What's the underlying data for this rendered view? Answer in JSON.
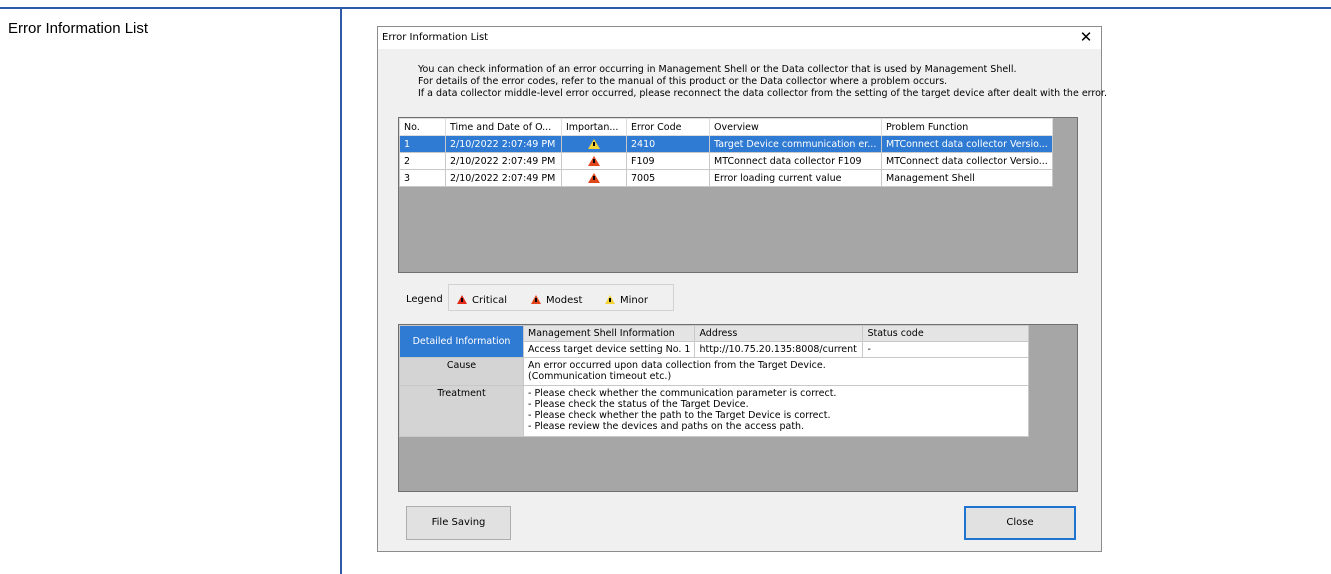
{
  "page": {
    "section_title": "Error Information List"
  },
  "dialog": {
    "title": "Error Information List",
    "close_glyph": "✕",
    "intro": [
      "You can check information of an error occurring in Management Shell or the Data collector that is used by Management Shell.",
      "For details of the error codes, refer to the manual of this product or the Data collector where a problem occurs.",
      "If a data collector middle-level error occurred, please reconnect the data collector from the setting of the target device after dealt with the error."
    ],
    "error_table": {
      "columns": [
        "No.",
        "Time and Date of O...",
        "Importan...",
        "Error Code",
        "Overview",
        "Problem Function"
      ],
      "rows": [
        {
          "no": "1",
          "time": "2/10/2022 2:07:49 PM",
          "importance": "minor",
          "code": "2410",
          "overview": "Target Device communication er...",
          "function": "MTConnect data collector Versio...",
          "selected": true
        },
        {
          "no": "2",
          "time": "2/10/2022 2:07:49 PM",
          "importance": "modest",
          "code": "F109",
          "overview": "MTConnect data collector F109",
          "function": "MTConnect data collector Versio...",
          "selected": false
        },
        {
          "no": "3",
          "time": "2/10/2022 2:07:49 PM",
          "importance": "modest",
          "code": "7005",
          "overview": "Error loading current value",
          "function": "Management Shell",
          "selected": false
        }
      ]
    },
    "legend": {
      "label": "Legend",
      "items": [
        {
          "label": "Critical",
          "icon": "critical-icon",
          "color": "#e32b1b"
        },
        {
          "label": "Modest",
          "icon": "modest-icon",
          "color": "#e0451b"
        },
        {
          "label": "Minor",
          "icon": "minor-icon",
          "color": "#f2d33a"
        }
      ]
    },
    "detail": {
      "detailed_information_label": "Detailed Information",
      "headers": [
        "Management Shell Information",
        "Address",
        "Status code"
      ],
      "values": [
        "Access target device setting No. 1",
        "http://10.75.20.135:8008/current",
        "-"
      ],
      "cause_label": "Cause",
      "cause_lines": [
        "An error occurred upon data collection from the Target Device.",
        "(Communication timeout etc.)"
      ],
      "treatment_label": "Treatment",
      "treatment_lines": [
        "- Please check whether the communication parameter is correct.",
        "- Please check the status of the Target Device.",
        "- Please check whether the path to the Target Device is correct.",
        "- Please review the devices and paths on the access path."
      ]
    },
    "buttons": {
      "file_saving": "File Saving",
      "close": "Close"
    }
  },
  "colors": {
    "selection": "#2f7ad3",
    "page_rule": "#2f5aa8",
    "panel_bg": "#a6a6a6"
  }
}
